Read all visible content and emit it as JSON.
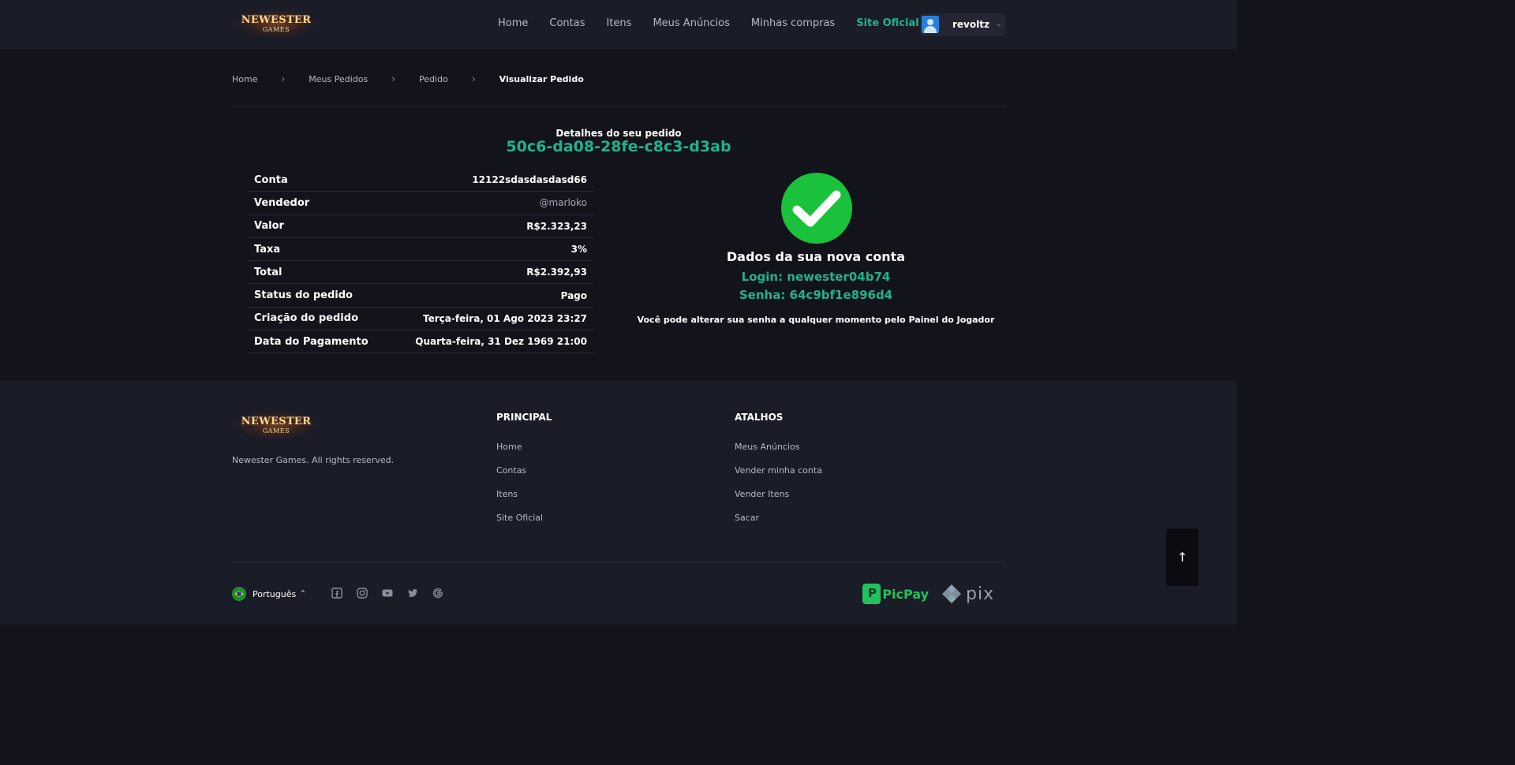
{
  "header": {
    "logo": {
      "line1": "NEWESTER",
      "line2": "GAMES"
    },
    "nav": [
      {
        "label": "Home"
      },
      {
        "label": "Contas"
      },
      {
        "label": "Itens"
      },
      {
        "label": "Meus Anúncios"
      },
      {
        "label": "Minhas compras"
      },
      {
        "label": "Site Oficial"
      }
    ],
    "user": {
      "name": "revoltz"
    }
  },
  "breadcrumb": [
    "Home",
    "Meus Pedidos",
    "Pedido",
    "Visualizar Pedido"
  ],
  "order": {
    "caption": "Detalhes do seu pedido",
    "id": "50c6-da08-28fe-c8c3-d3ab",
    "rows": [
      {
        "label": "Conta",
        "value": "12122sdasdasdasd66"
      },
      {
        "label": "Vendedor",
        "value": "@marloko"
      },
      {
        "label": "Valor",
        "value": "R$2.323,23"
      },
      {
        "label": "Taxa",
        "value": "3%"
      },
      {
        "label": "Total",
        "value": "R$2.392,93"
      },
      {
        "label": "Status do pedido",
        "value": "Pago"
      },
      {
        "label": "Criação do pedido",
        "value": "Terça-feira, 01 Ago 2023 23:27"
      },
      {
        "label": "Data do Pagamento",
        "value": "Quarta-feira, 31 Dez 1969 21:00"
      }
    ]
  },
  "account": {
    "title": "Dados da sua nova conta",
    "login": "Login: newester04b74",
    "senha": "Senha: 64c9bf1e896d4",
    "note": "Você pode alterar sua senha a qualquer momento pelo Painel do Jogador"
  },
  "footer": {
    "logo": {
      "line1": "NEWESTER",
      "line2": "GAMES"
    },
    "rights": "Newester Games. All rights reserved.",
    "principal": {
      "title": "PRINCIPAL",
      "links": [
        "Home",
        "Contas",
        "Itens",
        "Site Oficial"
      ]
    },
    "atalhos": {
      "title": "ATALHOS",
      "links": [
        "Meus Anúncios",
        "Vender minha conta",
        "Vender Itens",
        "Sacar"
      ]
    },
    "language": "Português",
    "payments": {
      "picpay": "PicPay",
      "pix": "pix"
    }
  },
  "colors": {
    "accent": "#1fb38c",
    "success": "#19c23a",
    "background": "#12131b",
    "panel": "#1a1c27"
  }
}
